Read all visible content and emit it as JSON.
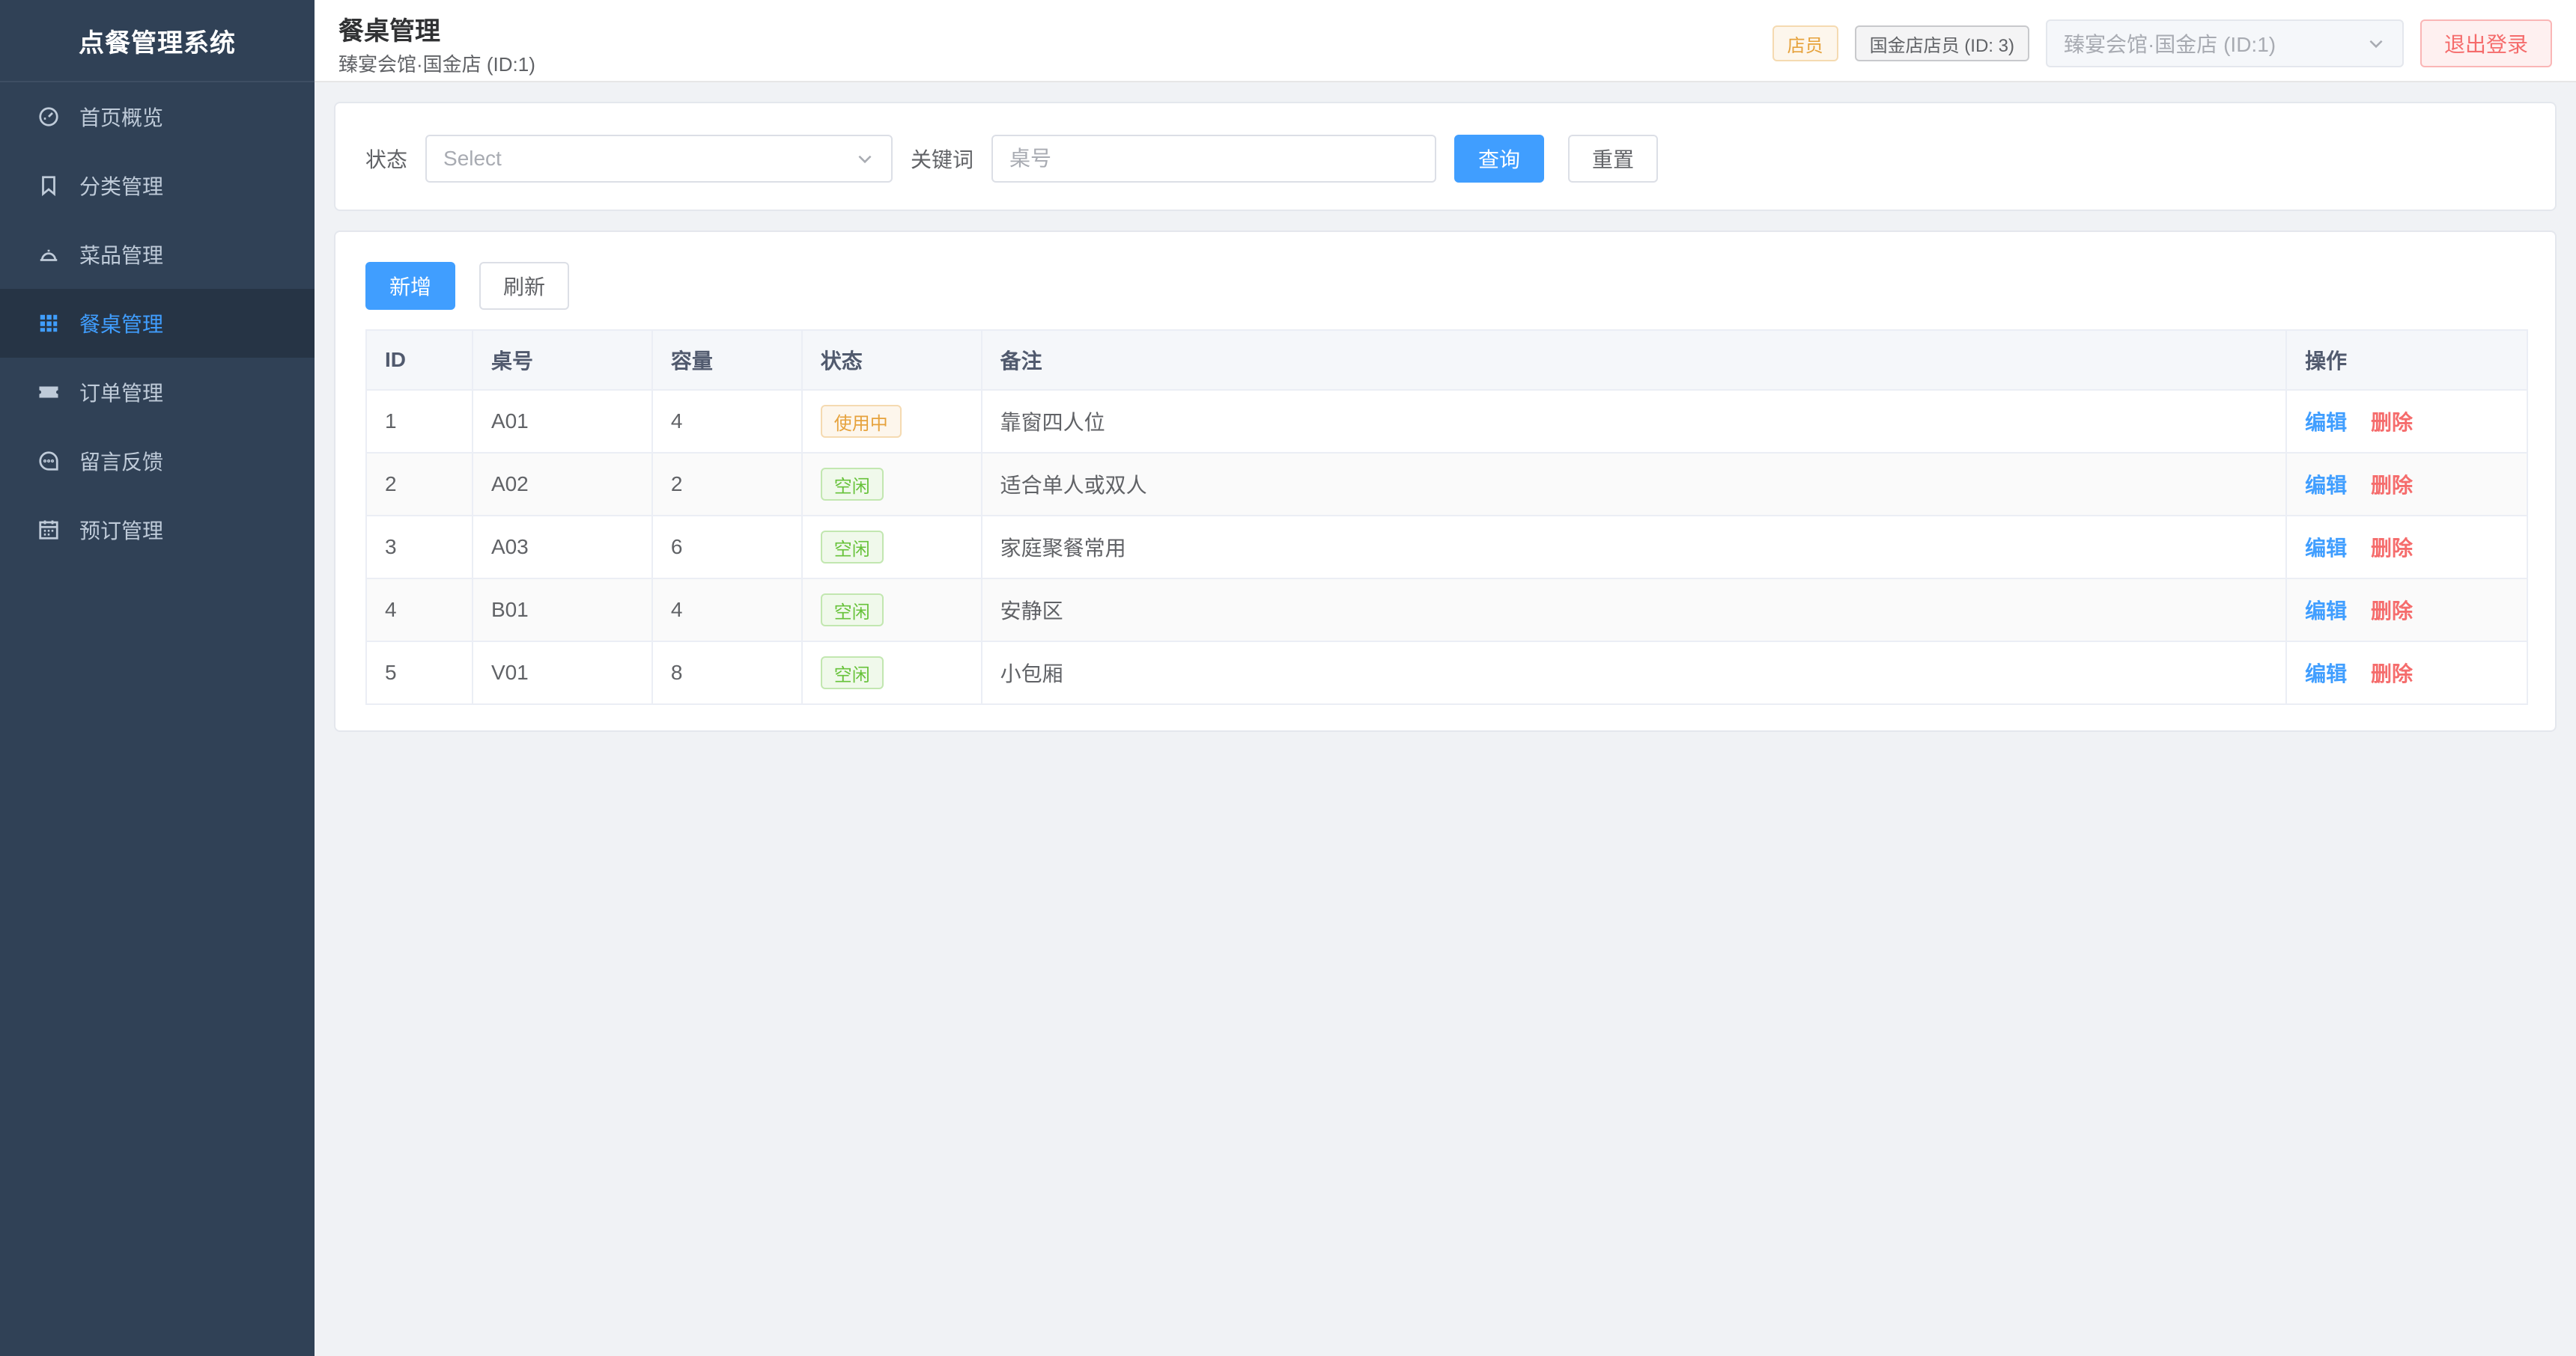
{
  "app": {
    "title": "点餐管理系统"
  },
  "sidebar": {
    "items": [
      {
        "label": "首页概览",
        "icon": "dashboard-icon"
      },
      {
        "label": "分类管理",
        "icon": "bookmark-icon"
      },
      {
        "label": "菜品管理",
        "icon": "dish-icon"
      },
      {
        "label": "餐桌管理",
        "icon": "grid-icon",
        "active": true
      },
      {
        "label": "订单管理",
        "icon": "ticket-icon"
      },
      {
        "label": "留言反馈",
        "icon": "chat-icon"
      },
      {
        "label": "预订管理",
        "icon": "calendar-icon"
      }
    ]
  },
  "header": {
    "title": "餐桌管理",
    "subtitle": "臻宴会馆·国金店 (ID:1)",
    "role_tag": "店员",
    "user_tag": "国金店店员 (ID: 3)",
    "store_select": "臻宴会馆·国金店 (ID:1)",
    "logout_label": "退出登录"
  },
  "filter": {
    "status_label": "状态",
    "status_placeholder": "Select",
    "keyword_label": "关键词",
    "keyword_placeholder": "桌号",
    "query_label": "查询",
    "reset_label": "重置"
  },
  "toolbar": {
    "add_label": "新增",
    "refresh_label": "刷新"
  },
  "table": {
    "columns": [
      "ID",
      "桌号",
      "容量",
      "状态",
      "备注",
      "操作"
    ],
    "edit_label": "编辑",
    "delete_label": "删除",
    "rows": [
      {
        "id": "1",
        "code": "A01",
        "capacity": "4",
        "status": "使用中",
        "remark": "靠窗四人位"
      },
      {
        "id": "2",
        "code": "A02",
        "capacity": "2",
        "status": "空闲",
        "remark": "适合单人或双人"
      },
      {
        "id": "3",
        "code": "A03",
        "capacity": "6",
        "status": "空闲",
        "remark": "家庭聚餐常用"
      },
      {
        "id": "4",
        "code": "B01",
        "capacity": "4",
        "status": "空闲",
        "remark": "安静区"
      },
      {
        "id": "5",
        "code": "V01",
        "capacity": "8",
        "status": "空闲",
        "remark": "小包厢"
      }
    ]
  },
  "colors": {
    "sidebar_bg": "#304156",
    "primary": "#409eff",
    "danger": "#f56c6c",
    "warning": "#e6a23c",
    "success": "#67c23a"
  }
}
